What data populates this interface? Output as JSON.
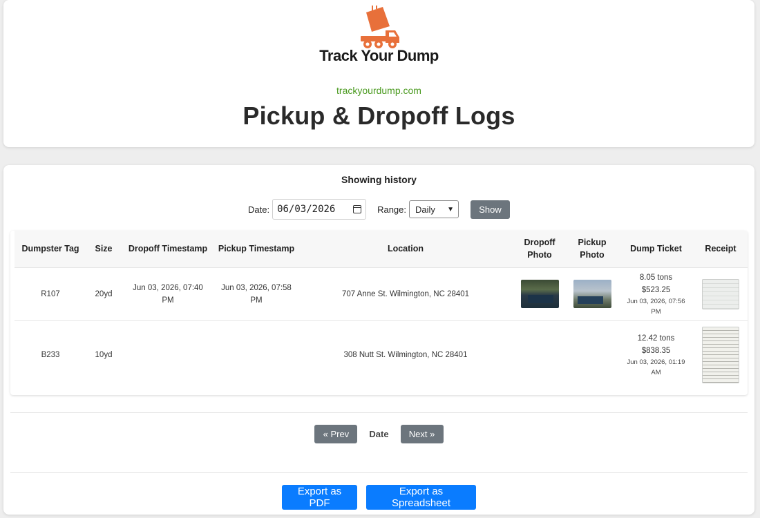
{
  "brand": {
    "name": "Track Your Dump",
    "site_link": "trackyourdump.com",
    "accent_color": "#e8703a"
  },
  "page": {
    "title": "Pickup & Dropoff Logs"
  },
  "history": {
    "heading": "Showing history",
    "date_label": "Date:",
    "date_value": "06/03/2026",
    "range_label": "Range:",
    "range_value": "Daily",
    "show_label": "Show"
  },
  "table": {
    "headers": {
      "tag": "Dumpster Tag",
      "size": "Size",
      "dropoff_ts": "Dropoff Timestamp",
      "pickup_ts": "Pickup Timestamp",
      "location": "Location",
      "dropoff_photo_1": "Dropoff",
      "dropoff_photo_2": "Photo",
      "pickup_photo_1": "Pickup",
      "pickup_photo_2": "Photo",
      "ticket": "Dump Ticket",
      "receipt": "Receipt"
    },
    "rows": [
      {
        "tag": "R107",
        "size": "20yd",
        "dropoff_ts_1": "Jun 03, 2026, 07:40",
        "dropoff_ts_2": "PM",
        "pickup_ts_1": "Jun 03, 2026, 07:58",
        "pickup_ts_2": "PM",
        "location": "707 Anne St. Wilmington, NC 28401",
        "ticket_tons": "8.05 tons",
        "ticket_amount": "$523.25",
        "ticket_time_1": "Jun 03, 2026, 07:56",
        "ticket_time_2": "PM"
      },
      {
        "tag": "B233",
        "size": "10yd",
        "location": "308 Nutt St. Wilmington, NC 28401",
        "ticket_tons": "12.42 tons",
        "ticket_amount": "$838.35",
        "ticket_time_1": "Jun 03, 2026, 01:19",
        "ticket_time_2": "AM"
      }
    ]
  },
  "pager": {
    "prev_label": "« Prev",
    "mode_label": "Date",
    "next_label": "Next »"
  },
  "exports": {
    "pdf_label": "Export as PDF",
    "spreadsheet_label": "Export as Spreadsheet"
  },
  "icons": {
    "logo": "dump-truck-logo-icon",
    "calendar": "calendar-icon",
    "dropdown": "chevron-down-icon"
  }
}
